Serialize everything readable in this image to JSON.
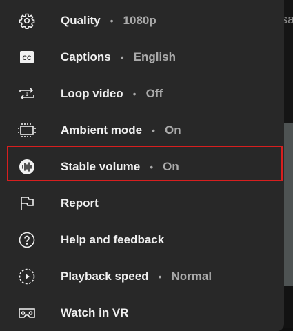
{
  "background": {
    "peek_text": "sa"
  },
  "menu": {
    "items": [
      {
        "label": "Quality",
        "value": "1080p",
        "icon": "gear-icon"
      },
      {
        "label": "Captions",
        "value": "English",
        "icon": "captions-icon"
      },
      {
        "label": "Loop video",
        "value": "Off",
        "icon": "loop-icon"
      },
      {
        "label": "Ambient mode",
        "value": "On",
        "icon": "ambient-mode-icon"
      },
      {
        "label": "Stable volume",
        "value": "On",
        "icon": "stable-volume-icon"
      },
      {
        "label": "Report",
        "value": "",
        "icon": "flag-icon"
      },
      {
        "label": "Help and feedback",
        "value": "",
        "icon": "help-icon"
      },
      {
        "label": "Playback speed",
        "value": "Normal",
        "icon": "playback-speed-icon"
      },
      {
        "label": "Watch in VR",
        "value": "",
        "icon": "vr-headset-icon"
      }
    ],
    "separator": "•"
  },
  "colors": {
    "sheet": "#282828",
    "highlight": "#d71f1f",
    "text": "#f1f1f1",
    "secondary": "#aaaaaa"
  }
}
